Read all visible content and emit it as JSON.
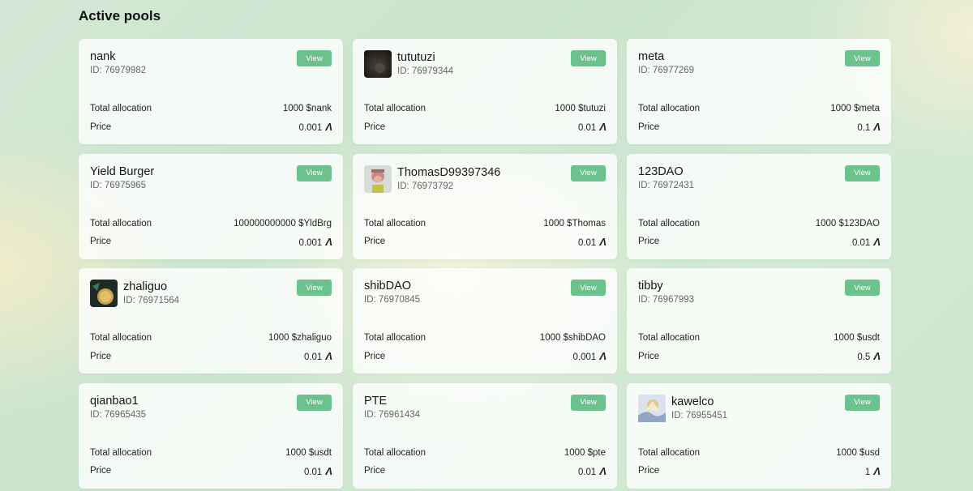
{
  "page": {
    "title": "Active pools"
  },
  "labels": {
    "view": "View",
    "total_allocation": "Total allocation",
    "price": "Price"
  },
  "currency_icon": "algorand-icon",
  "pools": [
    {
      "name": "nank",
      "id": "ID: 76979982",
      "allocation": "1000 $nank",
      "price": "0.001",
      "avatar": null
    },
    {
      "name": "tututuzi",
      "id": "ID: 76979344",
      "allocation": "1000 $tutuzi",
      "price": "0.01",
      "avatar": "dark"
    },
    {
      "name": "meta",
      "id": "ID: 76977269",
      "allocation": "1000 $meta",
      "price": "0.1",
      "avatar": null
    },
    {
      "name": "Yield Burger",
      "id": "ID: 76975965",
      "allocation": "100000000000 $YldBrg",
      "price": "0.001",
      "avatar": null
    },
    {
      "name": "ThomasD99397346",
      "id": "ID: 76973792",
      "allocation": "1000 $Thomas",
      "price": "0.01",
      "avatar": "ape"
    },
    {
      "name": "123DAO",
      "id": "ID: 76972431",
      "allocation": "1000 $123DAO",
      "price": "0.01",
      "avatar": null
    },
    {
      "name": "zhaliguo",
      "id": "ID: 76971564",
      "allocation": "1000 $zhaliguo",
      "price": "0.01",
      "avatar": "coin"
    },
    {
      "name": "shibDAO",
      "id": "ID: 76970845",
      "allocation": "1000 $shibDAO",
      "price": "0.001",
      "avatar": null
    },
    {
      "name": "tibby",
      "id": "ID: 76967993",
      "allocation": "1000 $usdt",
      "price": "0.5",
      "avatar": null
    },
    {
      "name": "qianbao1",
      "id": "ID: 76965435",
      "allocation": "1000 $usdt",
      "price": "0.01",
      "avatar": null
    },
    {
      "name": "PTE",
      "id": "ID: 76961434",
      "allocation": "1000 $pte",
      "price": "0.01",
      "avatar": null
    },
    {
      "name": "kawelco",
      "id": "ID: 76955451",
      "allocation": "1000 $usd",
      "price": "1",
      "avatar": "art"
    }
  ]
}
